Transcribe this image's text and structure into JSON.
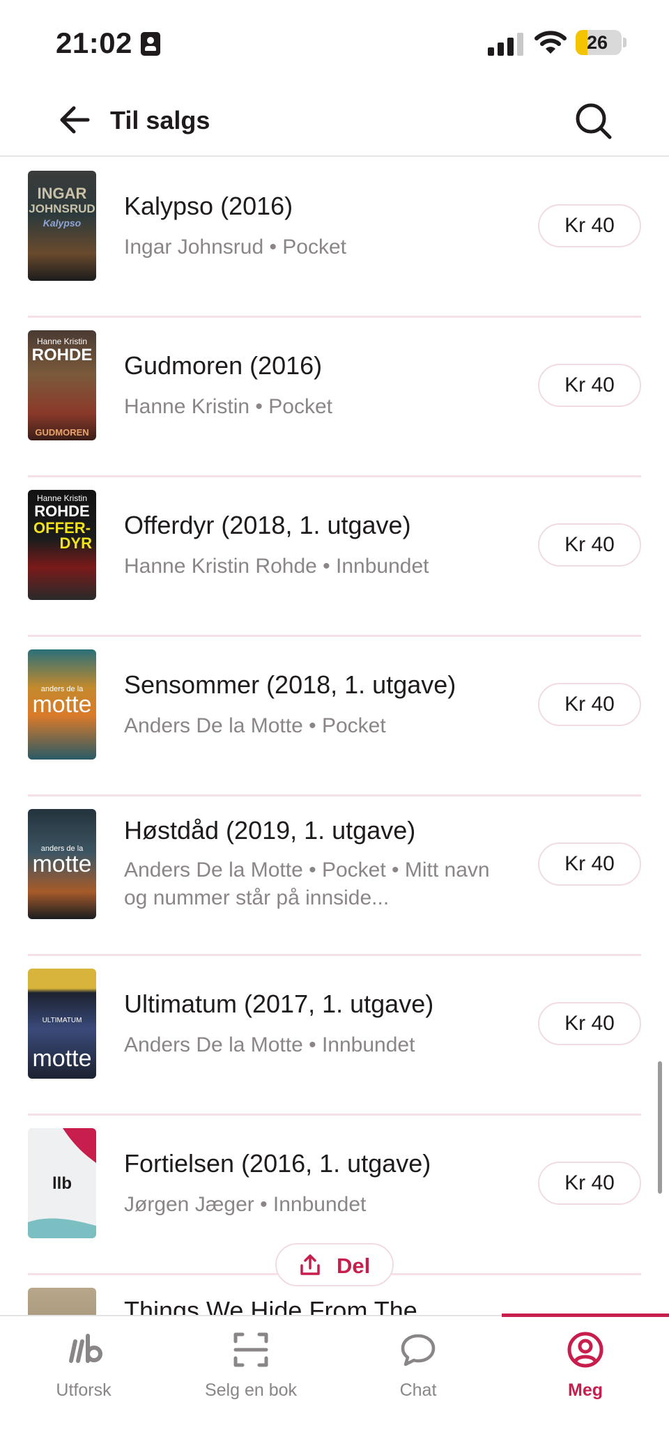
{
  "status_bar": {
    "time": "21:02",
    "battery": "26",
    "battery_level": 0.26
  },
  "header": {
    "title": "Til salgs",
    "back_icon": "arrow-left-icon",
    "search_icon": "search-icon"
  },
  "books": [
    {
      "title": "Kalypso (2016)",
      "meta": "Ingar Johnsrud • Pocket",
      "price": "Kr 40",
      "cover": {
        "lines": [
          "INGAR",
          "JOHNSRUD",
          "Kalypso"
        ],
        "colors": [
          "#2c3a3b",
          "#6a4a2d"
        ],
        "accent": "#c9c2a8"
      }
    },
    {
      "title": "Gudmoren (2016)",
      "meta": "Hanne Kristin • Pocket",
      "price": "Kr 40",
      "cover": {
        "lines": [
          "Hanne Kristin",
          "ROHDE",
          "GUDMOREN"
        ],
        "colors": [
          "#3a2b27",
          "#8b3a2a"
        ],
        "accent": "#ffffff"
      }
    },
    {
      "title": "Offerdyr (2018, 1. utgave)",
      "meta": "Hanne Kristin Rohde • Innbundet",
      "price": "Kr 40",
      "cover": {
        "lines": [
          "Hanne Kristin",
          "ROHDE",
          "OFFER-",
          "DYR"
        ],
        "colors": [
          "#121212",
          "#2a2a2a"
        ],
        "accent": "#f0e21b"
      }
    },
    {
      "title": "Sensommer (2018, 1. utgave)",
      "meta": "Anders De la Motte • Pocket",
      "price": "Kr 40",
      "cover": {
        "lines": [
          "anders de la",
          "motte"
        ],
        "colors": [
          "#c48a2c",
          "#2a5a66"
        ],
        "accent": "#ffffff"
      }
    },
    {
      "title": "Høstdåd (2019, 1. utgave)",
      "meta": "Anders De la Motte • Pocket • Mitt navn og nummer står på innside...",
      "price": "Kr 40",
      "cover": {
        "lines": [
          "anders de la",
          "motte"
        ],
        "colors": [
          "#24333d",
          "#a85b2a"
        ],
        "accent": "#ffffff"
      }
    },
    {
      "title": "Ultimatum (2017, 1. utgave)",
      "meta": "Anders De la Motte • Innbundet",
      "price": "Kr 40",
      "cover": {
        "lines": [
          "ULTIMATUM",
          "motte"
        ],
        "colors": [
          "#d9b43c",
          "#1c2230"
        ],
        "accent": "#ffffff"
      }
    },
    {
      "title": "Fortielsen (2016, 1. utgave)",
      "meta": "Jørgen Jæger • Innbundet",
      "price": "Kr 40",
      "cover": {
        "lines": [
          "llb"
        ],
        "colors": [
          "#eef0f1",
          "#eef0f1"
        ],
        "accent": "#c81e4e"
      }
    }
  ],
  "partial_book": {
    "title": "Things We Hide From The"
  },
  "share": {
    "label": "Del",
    "icon": "share-icon"
  },
  "nav": [
    {
      "label": "Utforsk",
      "icon": "llb-logo-icon"
    },
    {
      "label": "Selg en bok",
      "icon": "scan-icon"
    },
    {
      "label": "Chat",
      "icon": "chat-bubble-icon"
    },
    {
      "label": "Meg",
      "icon": "profile-icon",
      "active": true
    }
  ],
  "colors": {
    "accent": "#c81e4e",
    "divider": "#f6e1e6"
  }
}
